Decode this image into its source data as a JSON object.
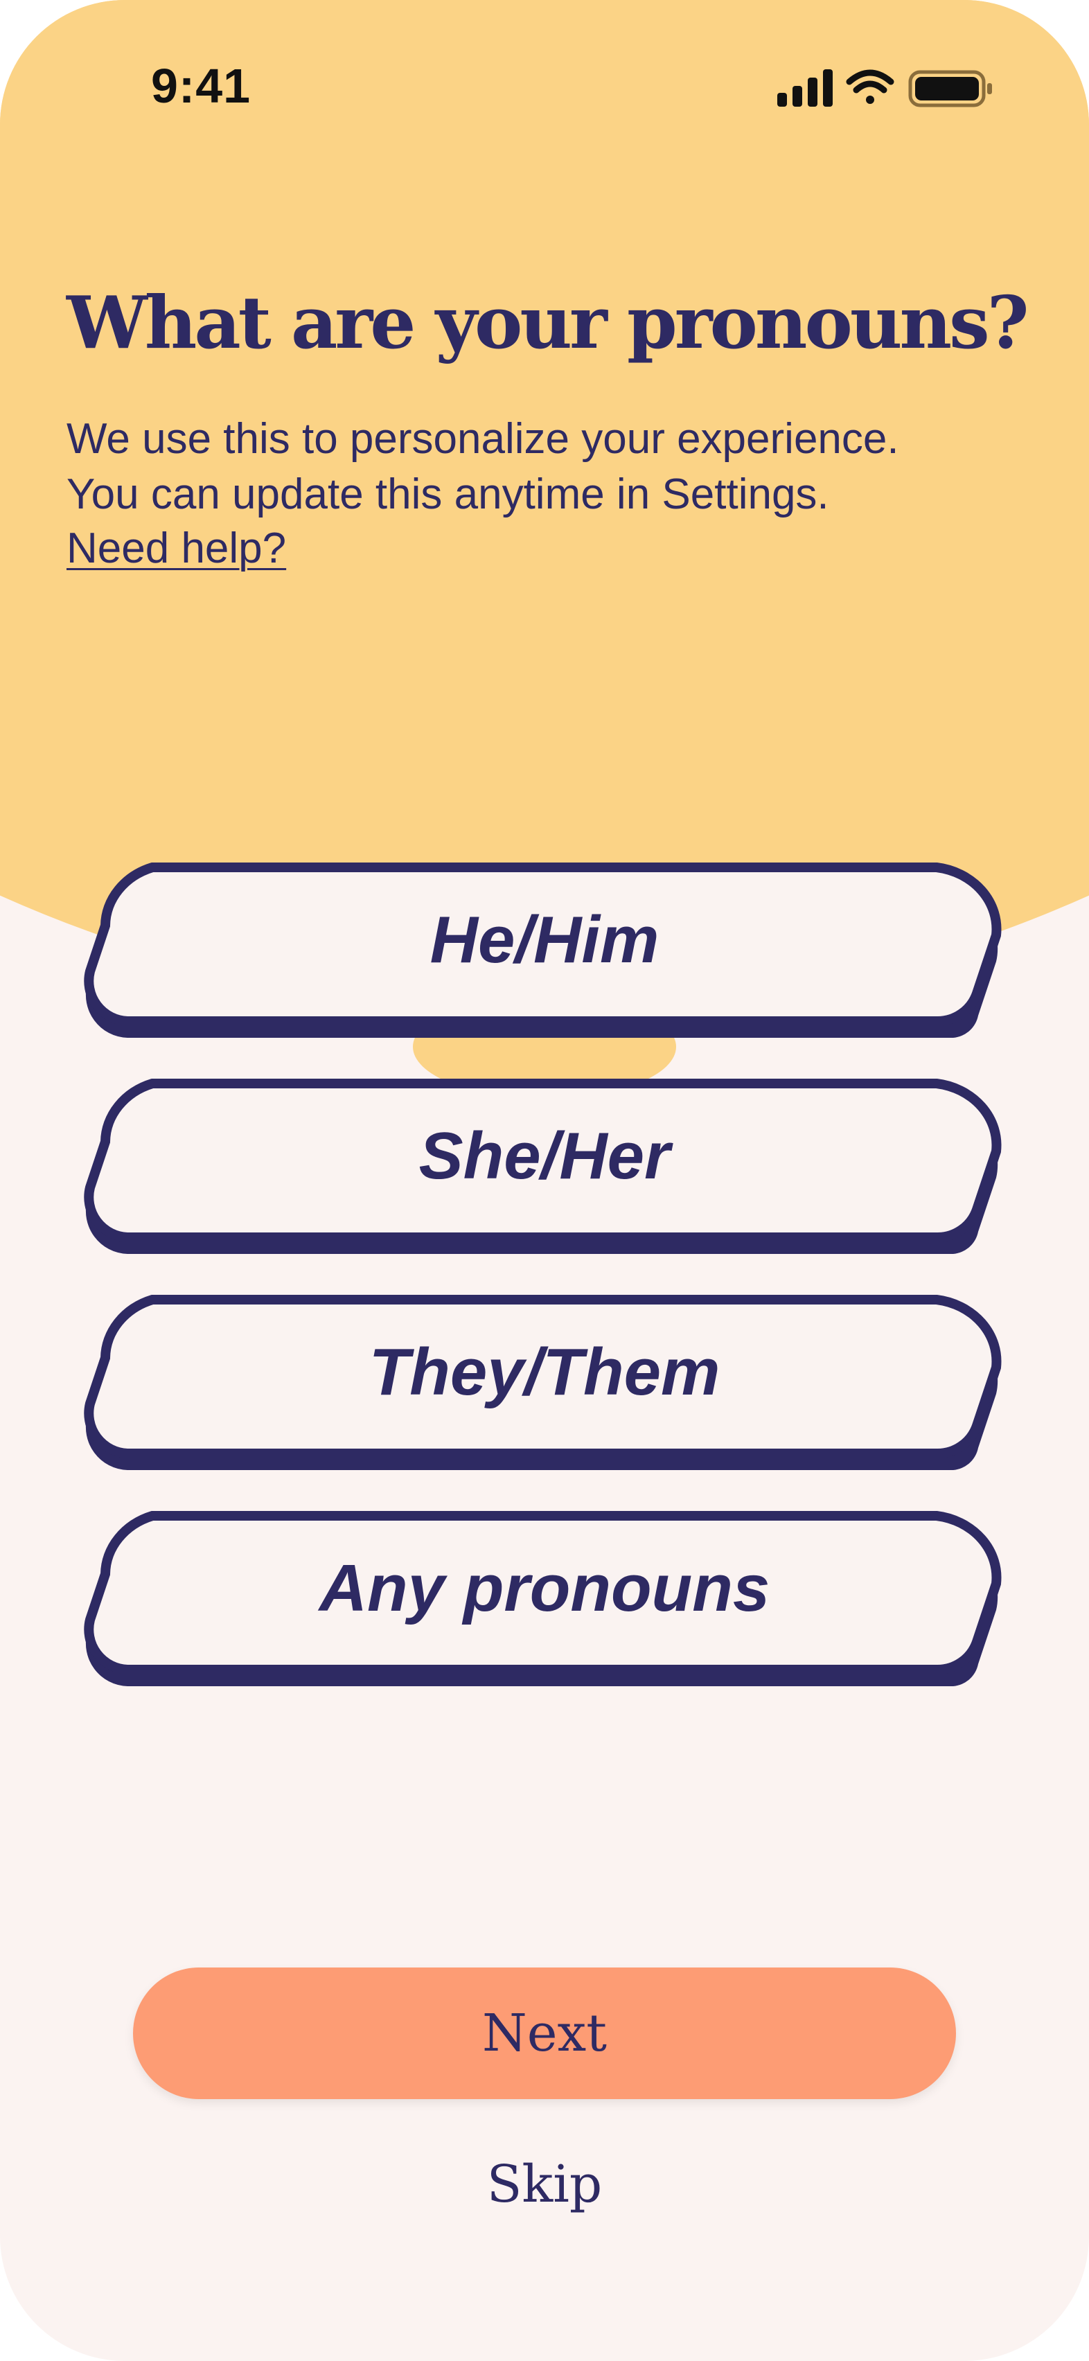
{
  "status_bar": {
    "time": "9:41",
    "icons": [
      "cellular-signal-icon",
      "wifi-icon",
      "battery-icon"
    ]
  },
  "header": {
    "title": "What are your pronouns?",
    "subtitle_line1": "We use this to personalize your experience.",
    "subtitle_line2": "You can update this anytime in Settings.",
    "help_link": "Need help?"
  },
  "options": [
    {
      "label": "He/Him"
    },
    {
      "label": "She/Her"
    },
    {
      "label": "They/Them"
    },
    {
      "label": "Any pronouns"
    }
  ],
  "actions": {
    "next_label": "Next",
    "skip_label": "Skip"
  },
  "colors": {
    "top_background": "#FBD386",
    "page_background": "#FBF3F1",
    "ink": "#2E2A63",
    "option_fill": "#FAF3F1",
    "next_button": "#FD9C74"
  }
}
